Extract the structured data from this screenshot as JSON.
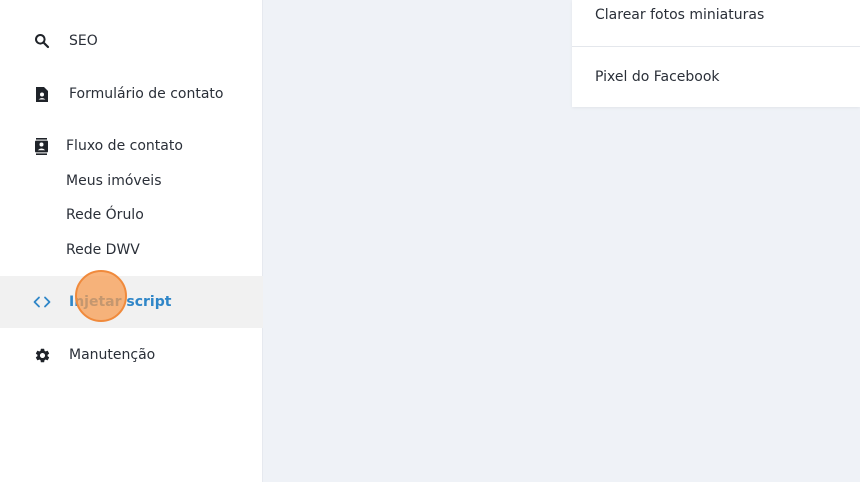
{
  "sidebar": {
    "items": [
      {
        "label": "SEO",
        "icon": "search-icon"
      },
      {
        "label": "Formulário de contato",
        "icon": "contact-form-icon"
      },
      {
        "label": "Fluxo de contato",
        "icon": "contact-flow-icon"
      },
      {
        "label": "Injetar script",
        "icon": "code-icon",
        "active": true
      },
      {
        "label": "Manutenção",
        "icon": "gear-icon"
      }
    ],
    "sub_items": [
      {
        "label": "Meus imóveis"
      },
      {
        "label": "Rede Órulo"
      },
      {
        "label": "Rede DWV"
      }
    ]
  },
  "panel": {
    "items": [
      {
        "label": "Clarear fotos miniaturas"
      },
      {
        "label": "Pixel do Facebook"
      }
    ]
  },
  "colors": {
    "accent": "#2f86c8",
    "active_bg": "#f1f1f1",
    "background": "#eff2f7",
    "click_indicator": "#f79c52"
  }
}
